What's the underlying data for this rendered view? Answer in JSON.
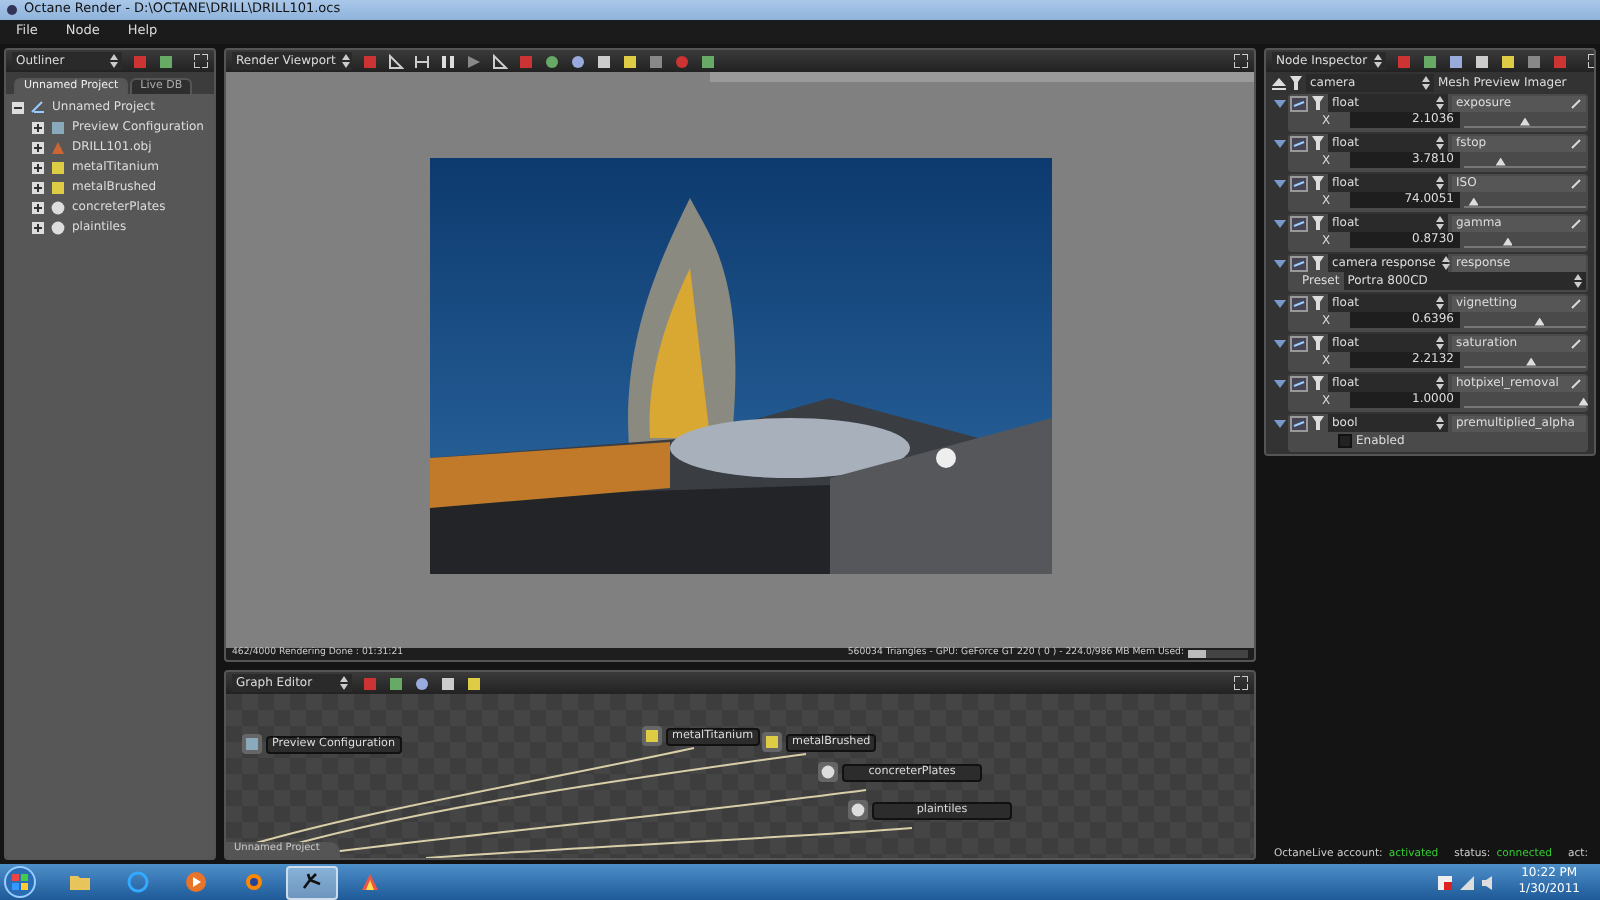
{
  "window": {
    "title": "Octane Render - D:\\OCTANE\\DRILL\\DRILL101.ocs"
  },
  "menu": [
    "File",
    "Node",
    "Help"
  ],
  "outliner": {
    "title": "Outliner",
    "tabs": [
      {
        "label": "Unnamed Project",
        "selected": true
      },
      {
        "label": "Live DB",
        "selected": false
      }
    ],
    "tree": [
      {
        "label": "Unnamed Project",
        "kind": "project",
        "expanded": true,
        "children": [
          {
            "label": "Preview Configuration",
            "kind": "config",
            "expanded": false
          },
          {
            "label": "DRILL101.obj",
            "kind": "mesh",
            "expanded": false
          },
          {
            "label": "metalTitanium",
            "kind": "material",
            "expanded": false
          },
          {
            "label": "metalBrushed",
            "kind": "material",
            "expanded": false
          },
          {
            "label": "concreterPlates",
            "kind": "sphere",
            "expanded": false
          },
          {
            "label": "plaintiles",
            "kind": "sphere",
            "expanded": false
          }
        ]
      }
    ]
  },
  "viewport": {
    "title": "Render Viewport",
    "status_left": "462/4000 Rendering Done : 01:31:21",
    "status_right": "560034 Triangles - GPU: GeForce GT 220 ( 0 ) - 224.0/986 MB Mem Used:",
    "mem_meter": {
      "level": 0.3
    }
  },
  "graph_editor": {
    "title": "Graph Editor",
    "tab": "Unnamed Project",
    "nodes": [
      {
        "label": "Preview Configuration",
        "kind": "config"
      },
      {
        "label": "metalTitanium",
        "kind": "material"
      },
      {
        "label": "metalBrushed",
        "kind": "material"
      },
      {
        "label": "concreterPlates",
        "kind": "sphere"
      },
      {
        "label": "plaintiles",
        "kind": "sphere"
      }
    ]
  },
  "inspector": {
    "title": "Node Inspector",
    "node_type": "camera",
    "node_name": "Mesh Preview Imager",
    "params": [
      {
        "kind": "float",
        "type": "float",
        "name": "exposure",
        "axis": "X",
        "value": "2.1036",
        "level": 0.5
      },
      {
        "kind": "float",
        "type": "float",
        "name": "fstop",
        "axis": "X",
        "value": "3.7810",
        "level": 0.3
      },
      {
        "kind": "float",
        "type": "float",
        "name": "ISO",
        "axis": "X",
        "value": "74.0051",
        "level": 0.08
      },
      {
        "kind": "float",
        "type": "float",
        "name": "gamma",
        "axis": "X",
        "value": "0.8730",
        "level": 0.36
      },
      {
        "kind": "enum",
        "type": "camera response",
        "name": "response",
        "preset_label": "Preset",
        "preset": "Portra 800CD"
      },
      {
        "kind": "float",
        "type": "float",
        "name": "vignetting",
        "axis": "X",
        "value": "0.6396",
        "level": 0.62
      },
      {
        "kind": "float",
        "type": "float",
        "name": "saturation",
        "axis": "X",
        "value": "2.2132",
        "level": 0.55
      },
      {
        "kind": "float",
        "type": "float",
        "name": "hotpixel_removal",
        "axis": "X",
        "value": "1.0000",
        "level": 0.98
      },
      {
        "kind": "bool",
        "type": "bool",
        "name": "premultiplied_alpha",
        "option": "Enabled",
        "checked": false
      }
    ]
  },
  "status_bar": {
    "account_label": "OctaneLive account:",
    "account": "activated",
    "status_label": "status:",
    "status": "connected",
    "act": "act:"
  },
  "taskbar": {
    "apps": [
      {
        "kind": "folder",
        "selected": false
      },
      {
        "kind": "browser",
        "selected": false
      },
      {
        "kind": "media",
        "selected": false
      },
      {
        "kind": "blender",
        "selected": false
      },
      {
        "kind": "octane",
        "selected": true
      },
      {
        "kind": "paint",
        "selected": false
      }
    ],
    "time": "10:22 PM",
    "date": "1/30/2011"
  }
}
